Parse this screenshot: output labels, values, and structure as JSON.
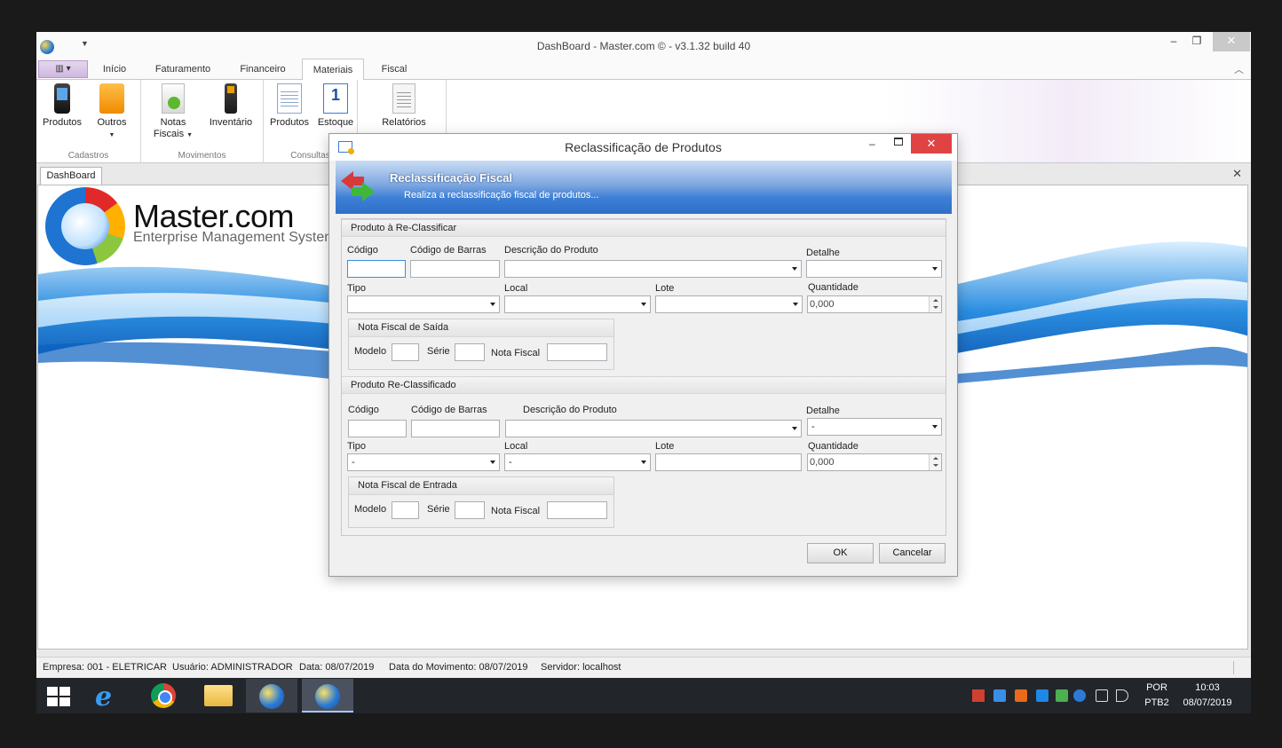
{
  "window": {
    "title": "DashBoard - Master.com © - v3.1.32 build 40",
    "min_label": "–",
    "max_label": "❐",
    "close_label": "✕"
  },
  "ribbon": {
    "tabs": [
      "Início",
      "Faturamento",
      "Financeiro",
      "Materiais",
      "Fiscal"
    ],
    "active_tab": "Materiais",
    "groups": {
      "cadastros": {
        "label": "Cadastros",
        "buttons": [
          "Produtos",
          "Outros"
        ]
      },
      "movimentos": {
        "label": "Movimentos",
        "buttons": [
          "Notas\nFiscais",
          "Inventário"
        ],
        "notas_line1": "Notas",
        "notas_line2": "Fiscais"
      },
      "consultas": {
        "label": "Consultas",
        "buttons": [
          "Produtos",
          "Estoque"
        ]
      },
      "relatorios": {
        "buttons": [
          "Relatórios"
        ]
      }
    }
  },
  "document": {
    "tab_label": "DashBoard",
    "close_label": "✕",
    "logo_name": "Master.com",
    "logo_sub": "Enterprise Management System"
  },
  "dialog": {
    "title": "Reclassificação de Produtos",
    "banner_title": "Reclassificação Fiscal",
    "banner_subtitle": "Realiza a reclassificação fiscal de produtos...",
    "section1": {
      "title": "Produto à Re-Classificar",
      "labels": {
        "codigo": "Código",
        "codigo_barras": "Código de Barras",
        "descricao": "Descrição do Produto",
        "detalhe": "Detalhe",
        "tipo": "Tipo",
        "local": "Local",
        "lote": "Lote",
        "quantidade": "Quantidade"
      },
      "values": {
        "codigo": "",
        "codigo_barras": "",
        "descricao": "",
        "detalhe": "",
        "tipo": "",
        "local": "",
        "lote": "",
        "quantidade": "0,000"
      },
      "nf": {
        "title": "Nota Fiscal de Saída",
        "modelo": "Modelo",
        "serie": "Série",
        "nota": "Nota Fiscal"
      }
    },
    "section2": {
      "title": "Produto Re-Classificado",
      "labels": {
        "codigo": "Código",
        "codigo_barras": "Código de Barras",
        "descricao": "Descrição do Produto",
        "detalhe": "Detalhe",
        "tipo": "Tipo",
        "local": "Local",
        "lote": "Lote",
        "quantidade": "Quantidade"
      },
      "values": {
        "codigo": "",
        "codigo_barras": "",
        "descricao": "",
        "detalhe": "-",
        "tipo": "-",
        "local": "-",
        "lote": "",
        "quantidade": "0,000"
      },
      "nf": {
        "title": "Nota Fiscal de Entrada",
        "modelo": "Modelo",
        "serie": "Série",
        "nota": "Nota Fiscal"
      }
    },
    "ok_label": "OK",
    "cancel_label": "Cancelar"
  },
  "statusbar": {
    "empresa": "Empresa: 001 - ELETRICAR",
    "usuario": "Usuário: ADMINISTRADOR",
    "data": "Data: 08/07/2019",
    "data_movimento": "Data do Movimento: 08/07/2019",
    "servidor": "Servidor: localhost"
  },
  "taskbar": {
    "language_line1": "POR",
    "language_line2": "PTB2",
    "time": "10:03",
    "date": "08/07/2019"
  },
  "colors": {
    "dialog_close": "#e04343",
    "banner_blue": "#2f6fc8",
    "active_tab_border": "#c8c8c8",
    "taskbar": "#22252a"
  }
}
